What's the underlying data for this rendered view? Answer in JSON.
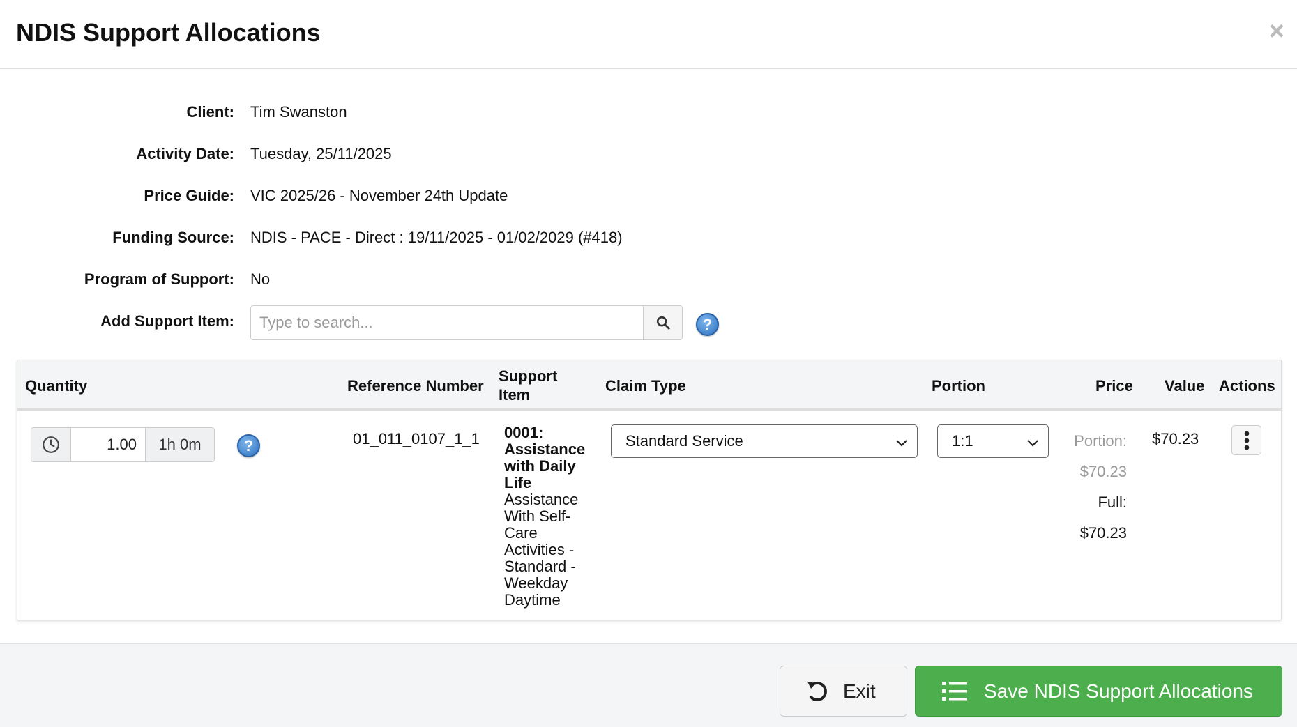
{
  "modal": {
    "title": "NDIS Support Allocations",
    "close_label": "×"
  },
  "fields": {
    "client_label": "Client:",
    "client_value": "Tim Swanston",
    "date_label": "Activity Date:",
    "date_value": "Tuesday, 25/11/2025",
    "price_guide_label": "Price Guide:",
    "price_guide_value": "VIC 2025/26 - November 24th Update",
    "funding_label": "Funding Source:",
    "funding_value": "NDIS - PACE - Direct : 19/11/2025 - 01/02/2029 (#418)",
    "program_label": "Program of Support:",
    "program_value": "No",
    "add_item_label": "Add Support Item:",
    "search_placeholder": "Type to search..."
  },
  "table": {
    "headers": {
      "quantity": "Quantity",
      "reference": "Reference Number",
      "support_line1": "Support",
      "support_line2": "Item",
      "claim_type": "Claim Type",
      "portion": "Portion",
      "price": "Price",
      "value": "Value",
      "actions": "Actions"
    },
    "row": {
      "quantity": "1.00",
      "duration": "1h 0m",
      "reference": "01_011_0107_1_1",
      "support_item_title": "0001: Assistance with Daily Life",
      "support_item_desc": "Assistance With Self-Care Activities - Standard - Weekday Daytime",
      "claim_type": "Standard Service",
      "portion": "1:1",
      "portion_label": "Portion:",
      "portion_price": "$70.23",
      "full_label": "Full:",
      "full_price": "$70.23",
      "value": "$70.23"
    }
  },
  "footer": {
    "exit_label": "Exit",
    "save_label": "Save NDIS Support Allocations"
  },
  "icons": {
    "help": "?",
    "search": "search-icon",
    "clock": "clock-icon",
    "chevron": "chevron-down-icon",
    "kebab": "vertical-dots-icon",
    "undo": "undo-icon",
    "list": "list-icon"
  },
  "colors": {
    "save_button": "#4cae4c",
    "help_icon": "#2e72c2"
  }
}
